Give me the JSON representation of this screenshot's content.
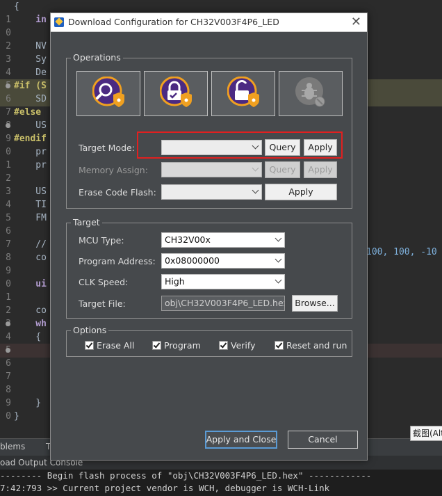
{
  "editor": {
    "lines": [
      {
        "num": "",
        "code": "{"
      },
      {
        "num": "1",
        "code": "    in"
      },
      {
        "num": "0",
        "code": ""
      },
      {
        "num": "2",
        "code": "    NV"
      },
      {
        "num": "3",
        "code": "    Sy"
      },
      {
        "num": "4",
        "code": "    De"
      },
      {
        "num": "5",
        "code": "#if (S"
      },
      {
        "num": "6",
        "code": "    SD"
      },
      {
        "num": "7",
        "code": "#else"
      },
      {
        "num": "8",
        "code": "    US"
      },
      {
        "num": "9",
        "code": "#endif"
      },
      {
        "num": "0",
        "code": "    pr"
      },
      {
        "num": "1",
        "code": "    pr"
      },
      {
        "num": "2",
        "code": ""
      },
      {
        "num": "3",
        "code": "    US"
      },
      {
        "num": "4",
        "code": "    TI"
      },
      {
        "num": "5",
        "code": "    FM"
      },
      {
        "num": "6",
        "code": ""
      },
      {
        "num": "7",
        "code": "    //"
      },
      {
        "num": "8",
        "code": "    co"
      },
      {
        "num": "9",
        "code": ""
      },
      {
        "num": "0",
        "code": "    ui"
      },
      {
        "num": "1",
        "code": ""
      },
      {
        "num": "2",
        "code": "    co"
      },
      {
        "num": "3",
        "code": "    wh"
      },
      {
        "num": "4",
        "code": "    {"
      },
      {
        "num": "5",
        "code": ""
      },
      {
        "num": "6",
        "code": ""
      },
      {
        "num": "7",
        "code": ""
      },
      {
        "num": "8",
        "code": ""
      },
      {
        "num": "9",
        "code": "    }"
      },
      {
        "num": "0",
        "code": "}"
      }
    ],
    "right_fragment": "100, 100, -10"
  },
  "bottom_tabs": {
    "problems": "blems",
    "tasks": "T"
  },
  "console": {
    "title": "oad Output Console",
    "line1": "-------- Begin flash process of \"obj\\CH32V003F4P6_LED.hex\" ------------",
    "line2": "7:42:793 >> Current project vendor is WCH, debugger is WCH-Link"
  },
  "tooltip": "截图(Alt",
  "dialog": {
    "title": "Download Configuration for CH32V003F4P6_LED",
    "close_glyph": "✕",
    "operations": {
      "label": "Operations",
      "buttons": [
        {
          "name": "query-chip-button",
          "icon": "search-shield-icon"
        },
        {
          "name": "lock-chip-button",
          "icon": "lock-shield-icon"
        },
        {
          "name": "unlock-chip-button",
          "icon": "unlock-shield-icon"
        },
        {
          "name": "debug-disabled-button",
          "icon": "bug-disabled-icon"
        }
      ],
      "target_mode_label": "Target Mode:",
      "target_mode_value": "",
      "memory_assign_label": "Memory Assign:",
      "memory_assign_value": "",
      "erase_code_flash_label": "Erase Code Flash:",
      "erase_code_flash_value": "",
      "query_label": "Query",
      "apply_label": "Apply"
    },
    "target": {
      "label": "Target",
      "mcu_type_label": "MCU Type:",
      "mcu_type_value": "CH32V00x",
      "program_address_label": "Program Address:",
      "program_address_value": "0x08000000",
      "clk_speed_label": "CLK Speed:",
      "clk_speed_value": "High",
      "target_file_label": "Target File:",
      "target_file_value": "obj\\CH32V003F4P6_LED.hex",
      "browse_label": "Browse..."
    },
    "options": {
      "label": "Options",
      "erase_all": "Erase All",
      "program": "Program",
      "verify": "Verify",
      "reset_and_run": "Reset and run"
    },
    "apply_and_close": "Apply and Close",
    "cancel": "Cancel"
  },
  "colors": {
    "dialog_bg": "#46494c",
    "highlight": "#e02020",
    "icon_purple": "#4b2a82",
    "icon_orange": "#f0a020"
  }
}
